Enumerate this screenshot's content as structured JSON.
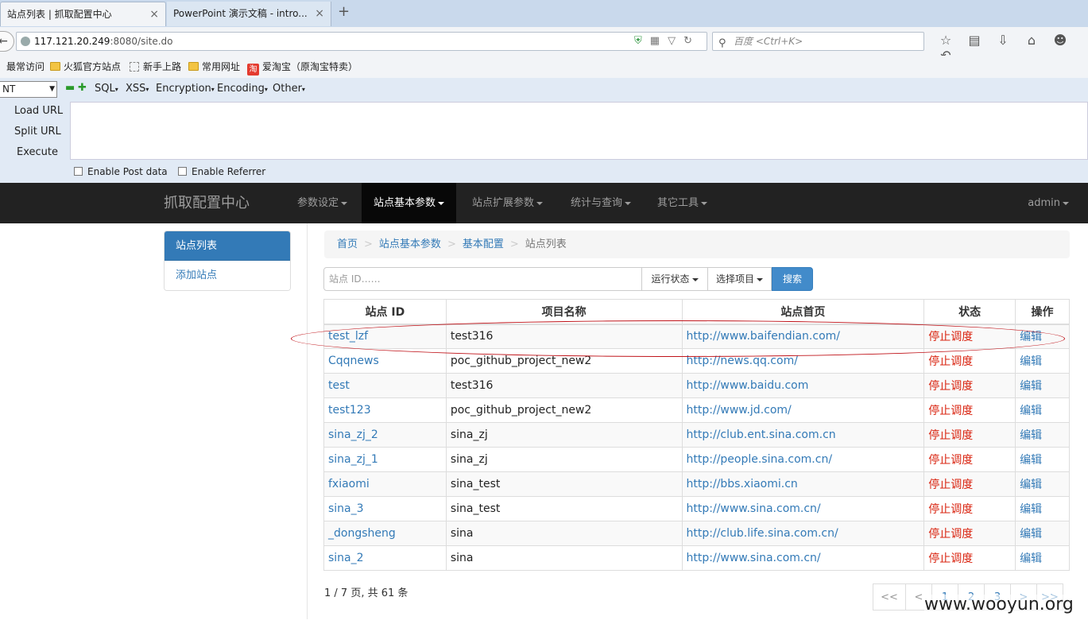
{
  "browser": {
    "tabs": [
      {
        "title": "站点列表 | 抓取配置中心",
        "close": "×"
      },
      {
        "title": "PowerPoint 演示文稿 - intro...",
        "close": "×"
      }
    ],
    "new_tab": "+",
    "url_host": "117.121.20.249",
    "url_rest": ":8080/site.do",
    "search_placeholder": "百度 <Ctrl+K>",
    "bookmarks": [
      "最常访问",
      "火狐官方站点",
      "新手上路",
      "常用网址",
      "爱淘宝（原淘宝特卖）"
    ],
    "tao_icon": "淘"
  },
  "hackbar": {
    "select_value": "NT",
    "menus": [
      "SQL",
      "XSS",
      "Encryption",
      "Encoding",
      "Other"
    ],
    "actions": [
      "Load URL",
      "Split URL",
      "Execute"
    ],
    "checks": [
      "Enable Post data",
      "Enable Referrer"
    ]
  },
  "app": {
    "brand": "抓取配置中心",
    "nav": [
      "参数设定",
      "站点基本参数",
      "站点扩展参数",
      "统计与查询",
      "其它工具"
    ],
    "user": "admin",
    "sidebar": [
      "站点列表",
      "添加站点"
    ],
    "breadcrumb": [
      "首页",
      "站点基本参数",
      "基本配置",
      "站点列表"
    ],
    "breadcrumb_sep": ">",
    "search_placeholder": "站点 ID……",
    "btn_status": "运行状态",
    "btn_project": "选择项目",
    "btn_search": "搜索",
    "columns": [
      "站点 ID",
      "项目名称",
      "站点首页",
      "状态",
      "操作"
    ],
    "rows": [
      {
        "id": "test_lzf",
        "project": "test316",
        "url": "http://www.baifendian.com/",
        "status": "停止调度",
        "op": "编辑"
      },
      {
        "id": "Cqqnews",
        "project": "poc_github_project_new2",
        "url": "http://news.qq.com/",
        "status": "停止调度",
        "op": "编辑"
      },
      {
        "id": "test",
        "project": "test316",
        "url": "http://www.baidu.com",
        "status": "停止调度",
        "op": "编辑"
      },
      {
        "id": "test123",
        "project": "poc_github_project_new2",
        "url": "http://www.jd.com/",
        "status": "停止调度",
        "op": "编辑"
      },
      {
        "id": "sina_zj_2",
        "project": "sina_zj",
        "url": "http://club.ent.sina.com.cn",
        "status": "停止调度",
        "op": "编辑"
      },
      {
        "id": "sina_zj_1",
        "project": "sina_zj",
        "url": "http://people.sina.com.cn/",
        "status": "停止调度",
        "op": "编辑"
      },
      {
        "id": "fxiaomi",
        "project": "sina_test",
        "url": "http://bbs.xiaomi.cn",
        "status": "停止调度",
        "op": "编辑"
      },
      {
        "id": "sina_3",
        "project": "sina_test",
        "url": "http://www.sina.com.cn/",
        "status": "停止调度",
        "op": "编辑"
      },
      {
        "id": "_dongsheng",
        "project": "sina",
        "url": "http://club.life.sina.com.cn/",
        "status": "停止调度",
        "op": "编辑"
      },
      {
        "id": "sina_2",
        "project": "sina",
        "url": "http://www.sina.com.cn/",
        "status": "停止调度",
        "op": "编辑"
      }
    ],
    "page_info": "1 / 7 页, 共 61 条",
    "pagination": [
      "<<",
      "<",
      "1",
      "2",
      "3",
      ">",
      ">>"
    ]
  },
  "watermark": "www.wooyun.org",
  "colors": {
    "accent": "#337ab7",
    "status": "#d9230f",
    "navbar": "#222222",
    "annotation": "#c0141a"
  }
}
